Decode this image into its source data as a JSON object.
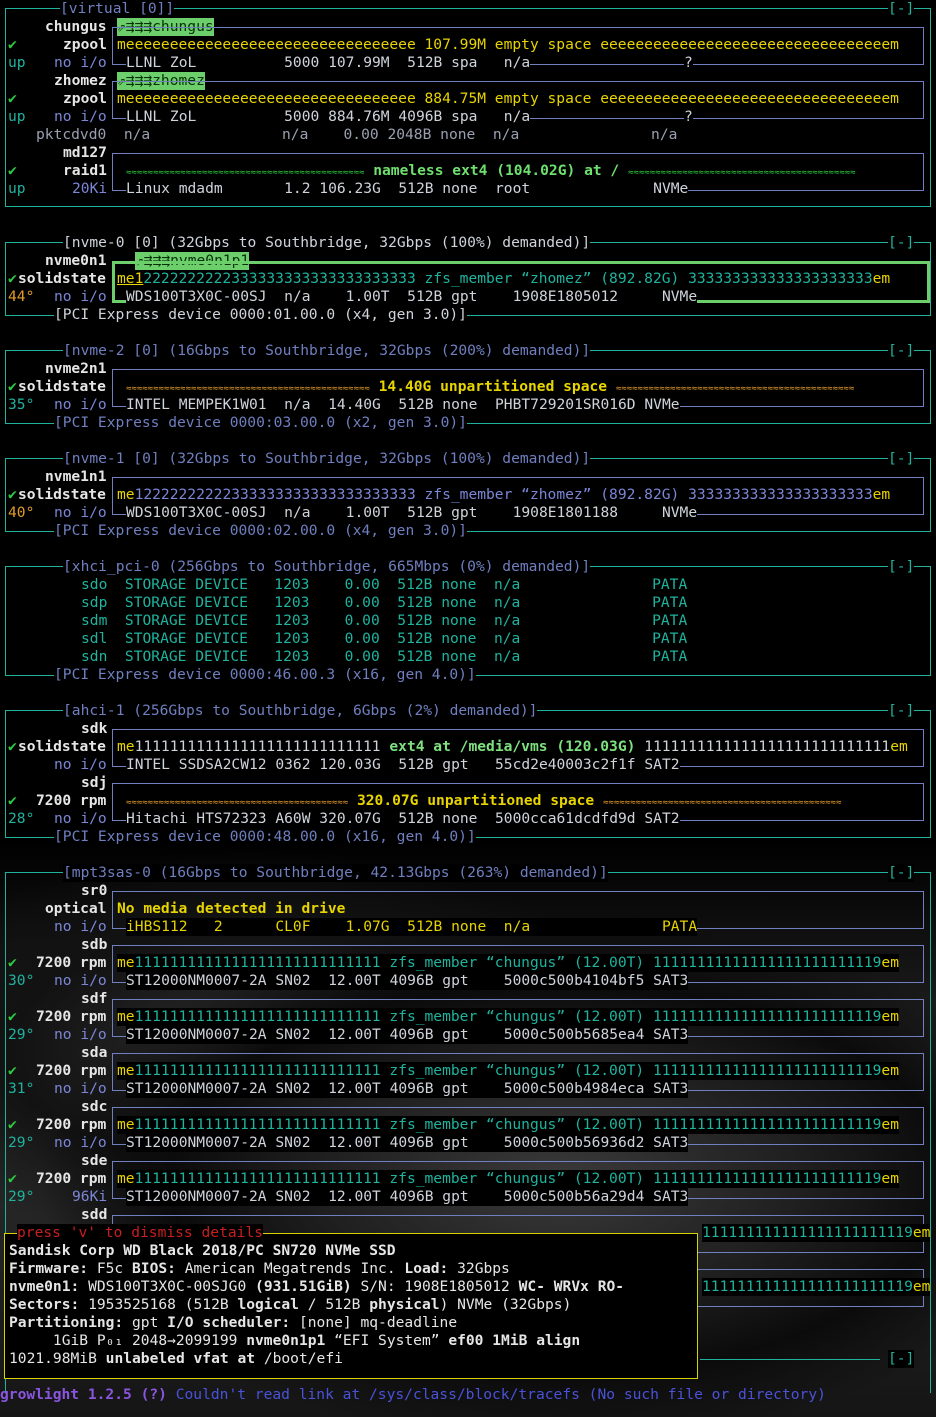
{
  "virtual": {
    "title": "[virtual [0]]",
    "collapse": "[-]"
  },
  "chungus": {
    "name": "chungus",
    "tag": "⇗⇶⇶⇶chungus",
    "state": "zpool",
    "check": "✔",
    "up": "up",
    "noio": "no i/o",
    "bar": "meeeeeeeeeeeeeeeeeeeeeeeeeeeeeeeee 107.99M empty space eeeeeeeeeeeeeeeeeeeeeeeeeeeeeeeeem",
    "details": "LLNL ZoL          5000 107.99M  512B spa   n/a",
    "q": "?"
  },
  "zhomez": {
    "name": "zhomez",
    "tag": "⇗⇶⇶⇶zhomez",
    "state": "zpool",
    "check": "✔",
    "up": "up",
    "noio": "no i/o",
    "bar": "meeeeeeeeeeeeeeeeeeeeeeeeeeeeeeeee 884.75M empty space eeeeeeeeeeeeeeeeeeeeeeeeeeeeeeeeem",
    "details": "LLNL ZoL          5000 884.76M 4096B spa   n/a",
    "q": "?"
  },
  "pktcdvd0": {
    "line": "pktcdvd0  n/a               n/a    0.00 2048B none  n/a               n/a"
  },
  "md127": {
    "name": "md127",
    "state": "raid1",
    "check": "✔",
    "up": "up",
    "rate": "20Ki",
    "wave1": "≈≈≈≈≈≈≈≈≈≈≈≈≈≈≈≈≈≈≈≈≈≈≈≈≈≈≈≈≈≈≈≈≈≈≈≈≈≈≈≈≈≈≈≈",
    "label": " nameless ext4 (104.02G) at / ",
    "wave2": "≈≈≈≈≈≈≈≈≈≈≈≈≈≈≈≈≈≈≈≈≈≈≈≈≈≈≈≈≈≈≈≈≈≈≈≈≈≈≈≈≈≈",
    "details": "Linux mdadm       1.2 106.23G  512B none  root              NVMe"
  },
  "nvme0": {
    "title": "[nvme-0 [0] (32Gbps to Southbridge, 32Gbps (100%) demanded)]",
    "collapse": "[-]",
    "name": "nvme0n1",
    "part": "⇗⇶⇶⇶nvme0n1p1",
    "state": "solidstate",
    "check": "✔",
    "temp": "44°",
    "noio": "no i/o",
    "bar_a": "me1",
    "bar_b": "2222222222333333333333333333333 zfs_member “zhomez” (892.82G) 333333333333333333333",
    "bar_c": "em",
    "details": "WDS100T3X0C-00SJ  n/a    1.00T  512B gpt    1908E1805012     NVMe",
    "pci": "[PCI Express device 0000:01.00.0 (x4, gen 3.0)]"
  },
  "nvme2": {
    "title": "[nvme-2 [0] (16Gbps to Southbridge, 32Gbps (200%) demanded)]",
    "collapse": "[-]",
    "name": "nvme2n1",
    "state": "solidstate",
    "check": "✔",
    "temp": "35°",
    "noio": "no i/o",
    "wave1": "≈≈≈≈≈≈≈≈≈≈≈≈≈≈≈≈≈≈≈≈≈≈≈≈≈≈≈≈≈≈≈≈≈≈≈≈≈≈≈≈≈≈≈≈≈",
    "label": " 14.40G unpartitioned space ",
    "wave2": "≈≈≈≈≈≈≈≈≈≈≈≈≈≈≈≈≈≈≈≈≈≈≈≈≈≈≈≈≈≈≈≈≈≈≈≈≈≈≈≈≈≈≈≈",
    "details": "INTEL MEMPEK1W01  n/a  14.40G  512B none  PHBT729201SR016D NVMe",
    "pci": "[PCI Express device 0000:03.00.0 (x2, gen 3.0)]"
  },
  "nvme1": {
    "title": "[nvme-1 [0] (32Gbps to Southbridge, 32Gbps (100%) demanded)]",
    "collapse": "[-]",
    "name": "nvme1n1",
    "state": "solidstate",
    "check": "✔",
    "temp": "40°",
    "noio": "no i/o",
    "bar_a": "me",
    "bar_b": "12222222222333333333333333333333 zfs_member “zhomez” (892.82G) 333333333333333333333",
    "bar_c": "em",
    "details": "WDS100T3X0C-00SJ  n/a    1.00T  512B gpt    1908E1801188     NVMe",
    "pci": "[PCI Express device 0000:02.00.0 (x4, gen 3.0)]"
  },
  "xhci": {
    "title": "[xhci_pci-0 (256Gbps to Southbridge, 665Mbps (0%) demanded)]",
    "collapse": "[-]",
    "rows": [
      "sdo  STORAGE DEVICE   1203    0.00  512B none  n/a               PATA",
      "sdp  STORAGE DEVICE   1203    0.00  512B none  n/a               PATA",
      "sdm  STORAGE DEVICE   1203    0.00  512B none  n/a               PATA",
      "sdl  STORAGE DEVICE   1203    0.00  512B none  n/a               PATA",
      "sdn  STORAGE DEVICE   1203    0.00  512B none  n/a               PATA"
    ],
    "pci": "[PCI Express device 0000:46.00.3 (x16, gen 4.0)]"
  },
  "ahci": {
    "title": "[ahci-1 (256Gbps to Southbridge, 6Gbps (2%) demanded)]",
    "collapse": "[-]",
    "sdk": {
      "name": "sdk",
      "state": "solidstate",
      "check": "✔",
      "noio": "no i/o",
      "bar_a": "me",
      "bar_b": "1111111111111111111111111111",
      "bar_c": " ext4 at /media/vms (120.03G) ",
      "bar_d": "1111111111111111111111111111",
      "bar_e": "em",
      "details": "INTEL SSDSA2CW12 0362 120.03G  512B gpt   55cd2e40003c2f1f SAT2"
    },
    "sdj": {
      "name": "sdj",
      "state": "7200 rpm",
      "check": "✔",
      "temp": "28°",
      "noio": "no i/o",
      "wave1": "≈≈≈≈≈≈≈≈≈≈≈≈≈≈≈≈≈≈≈≈≈≈≈≈≈≈≈≈≈≈≈≈≈≈≈≈≈≈≈≈≈",
      "label": " 320.07G unpartitioned space ",
      "wave2": "≈≈≈≈≈≈≈≈≈≈≈≈≈≈≈≈≈≈≈≈≈≈≈≈≈≈≈≈≈≈≈≈≈≈≈≈≈≈≈≈≈≈≈≈",
      "details": "Hitachi HTS72323 A60W 320.07G  512B none  5000cca61dcdfd9d SAT2"
    },
    "pci": "[PCI Express device 0000:48.00.0 (x16, gen 4.0)]"
  },
  "mpt": {
    "title": "[mpt3sas-0 (16Gbps to Southbridge, 42.13Gbps (263%) demanded)]",
    "collapse": "[-]",
    "sr0": {
      "name": "sr0",
      "state": "optical",
      "noio": "no i/o",
      "label": "No media detected in drive",
      "details": "iHBS112   2      CL0F    1.07G  512B none  n/a               PATA"
    },
    "disks": [
      {
        "name": "sdb",
        "check": "✔",
        "state": "7200 rpm",
        "temp": "30°",
        "io": "no i/o",
        "details": "ST12000NM0007-2A SN02  12.00T 4096B gpt    5000c500b4104bf5 SAT3"
      },
      {
        "name": "sdf",
        "check": "✔",
        "state": "7200 rpm",
        "temp": "29°",
        "io": "no i/o",
        "details": "ST12000NM0007-2A SN02  12.00T 4096B gpt    5000c500b5685ea4 SAT3"
      },
      {
        "name": "sda",
        "check": "✔",
        "state": "7200 rpm",
        "temp": "31°",
        "io": "no i/o",
        "details": "ST12000NM0007-2A SN02  12.00T 4096B gpt    5000c500b4984eca SAT3"
      },
      {
        "name": "sdc",
        "check": "✔",
        "state": "7200 rpm",
        "temp": "29°",
        "io": "no i/o",
        "details": "ST12000NM0007-2A SN02  12.00T 4096B gpt    5000c500b56936d2 SAT3"
      },
      {
        "name": "sde",
        "check": "✔",
        "state": "7200 rpm",
        "temp": "29°",
        "io": "96Ki",
        "details": "ST12000NM0007-2A SN02  12.00T 4096B gpt    5000c500b56a29d4 SAT3"
      }
    ],
    "bar_a": "me",
    "bar_b": "1111111111111111111111111111 zfs_member “chungus” (12.00T) 11111111111111111111111119",
    "bar_c": "em",
    "sdd": {
      "name": "sdd",
      "bar_tail": "111111111111111111111119",
      "bar_em": "em"
    },
    "collapse2": "[-]"
  },
  "details_popup": {
    "hint": "press 'v' to dismiss details",
    "l1": "Sandisk Corp WD Black 2018/PC SN720 NVMe SSD",
    "l2a": "Firmware:",
    "l2b": " F5c ",
    "l2c": "BIOS:",
    "l2d": " American Megatrends Inc. ",
    "l2e": "Load:",
    "l2f": " 32Gbps",
    "l3a": "nvme0n1:",
    "l3b": " WDS100T3X0C-00SJG0 ",
    "l3c": "(931.51GiB)",
    "l3d": " S/N: ",
    "l3e": "1908E1805012",
    "l3f": " WC- WRVx RO-",
    "l4a": "Sectors:",
    "l4b": " 1953525168 (512B ",
    "l4c": "logical",
    "l4d": " / 512B ",
    "l4e": "physical",
    "l4f": ") NVMe (32Gbps)",
    "l5a": "Partitioning:",
    "l5b": " gpt ",
    "l5c": "I/O scheduler:",
    "l5d": " [none] mq-deadline",
    "l6a": "     1GiB P₀₁ 2048→2099199 ",
    "l6b": "nvme0n1p1",
    "l6c": " “EFI System” ",
    "l6d": "ef00 1MiB align",
    "l7a": "1021.98MiB ",
    "l7b": "unlabeled vfat at",
    "l7c": " /boot/efi"
  },
  "status": {
    "app": "growlight 1.2.5 (?)",
    "msg": " Couldn't read link at /sys/class/block/tracefs (No such file or directory)"
  }
}
